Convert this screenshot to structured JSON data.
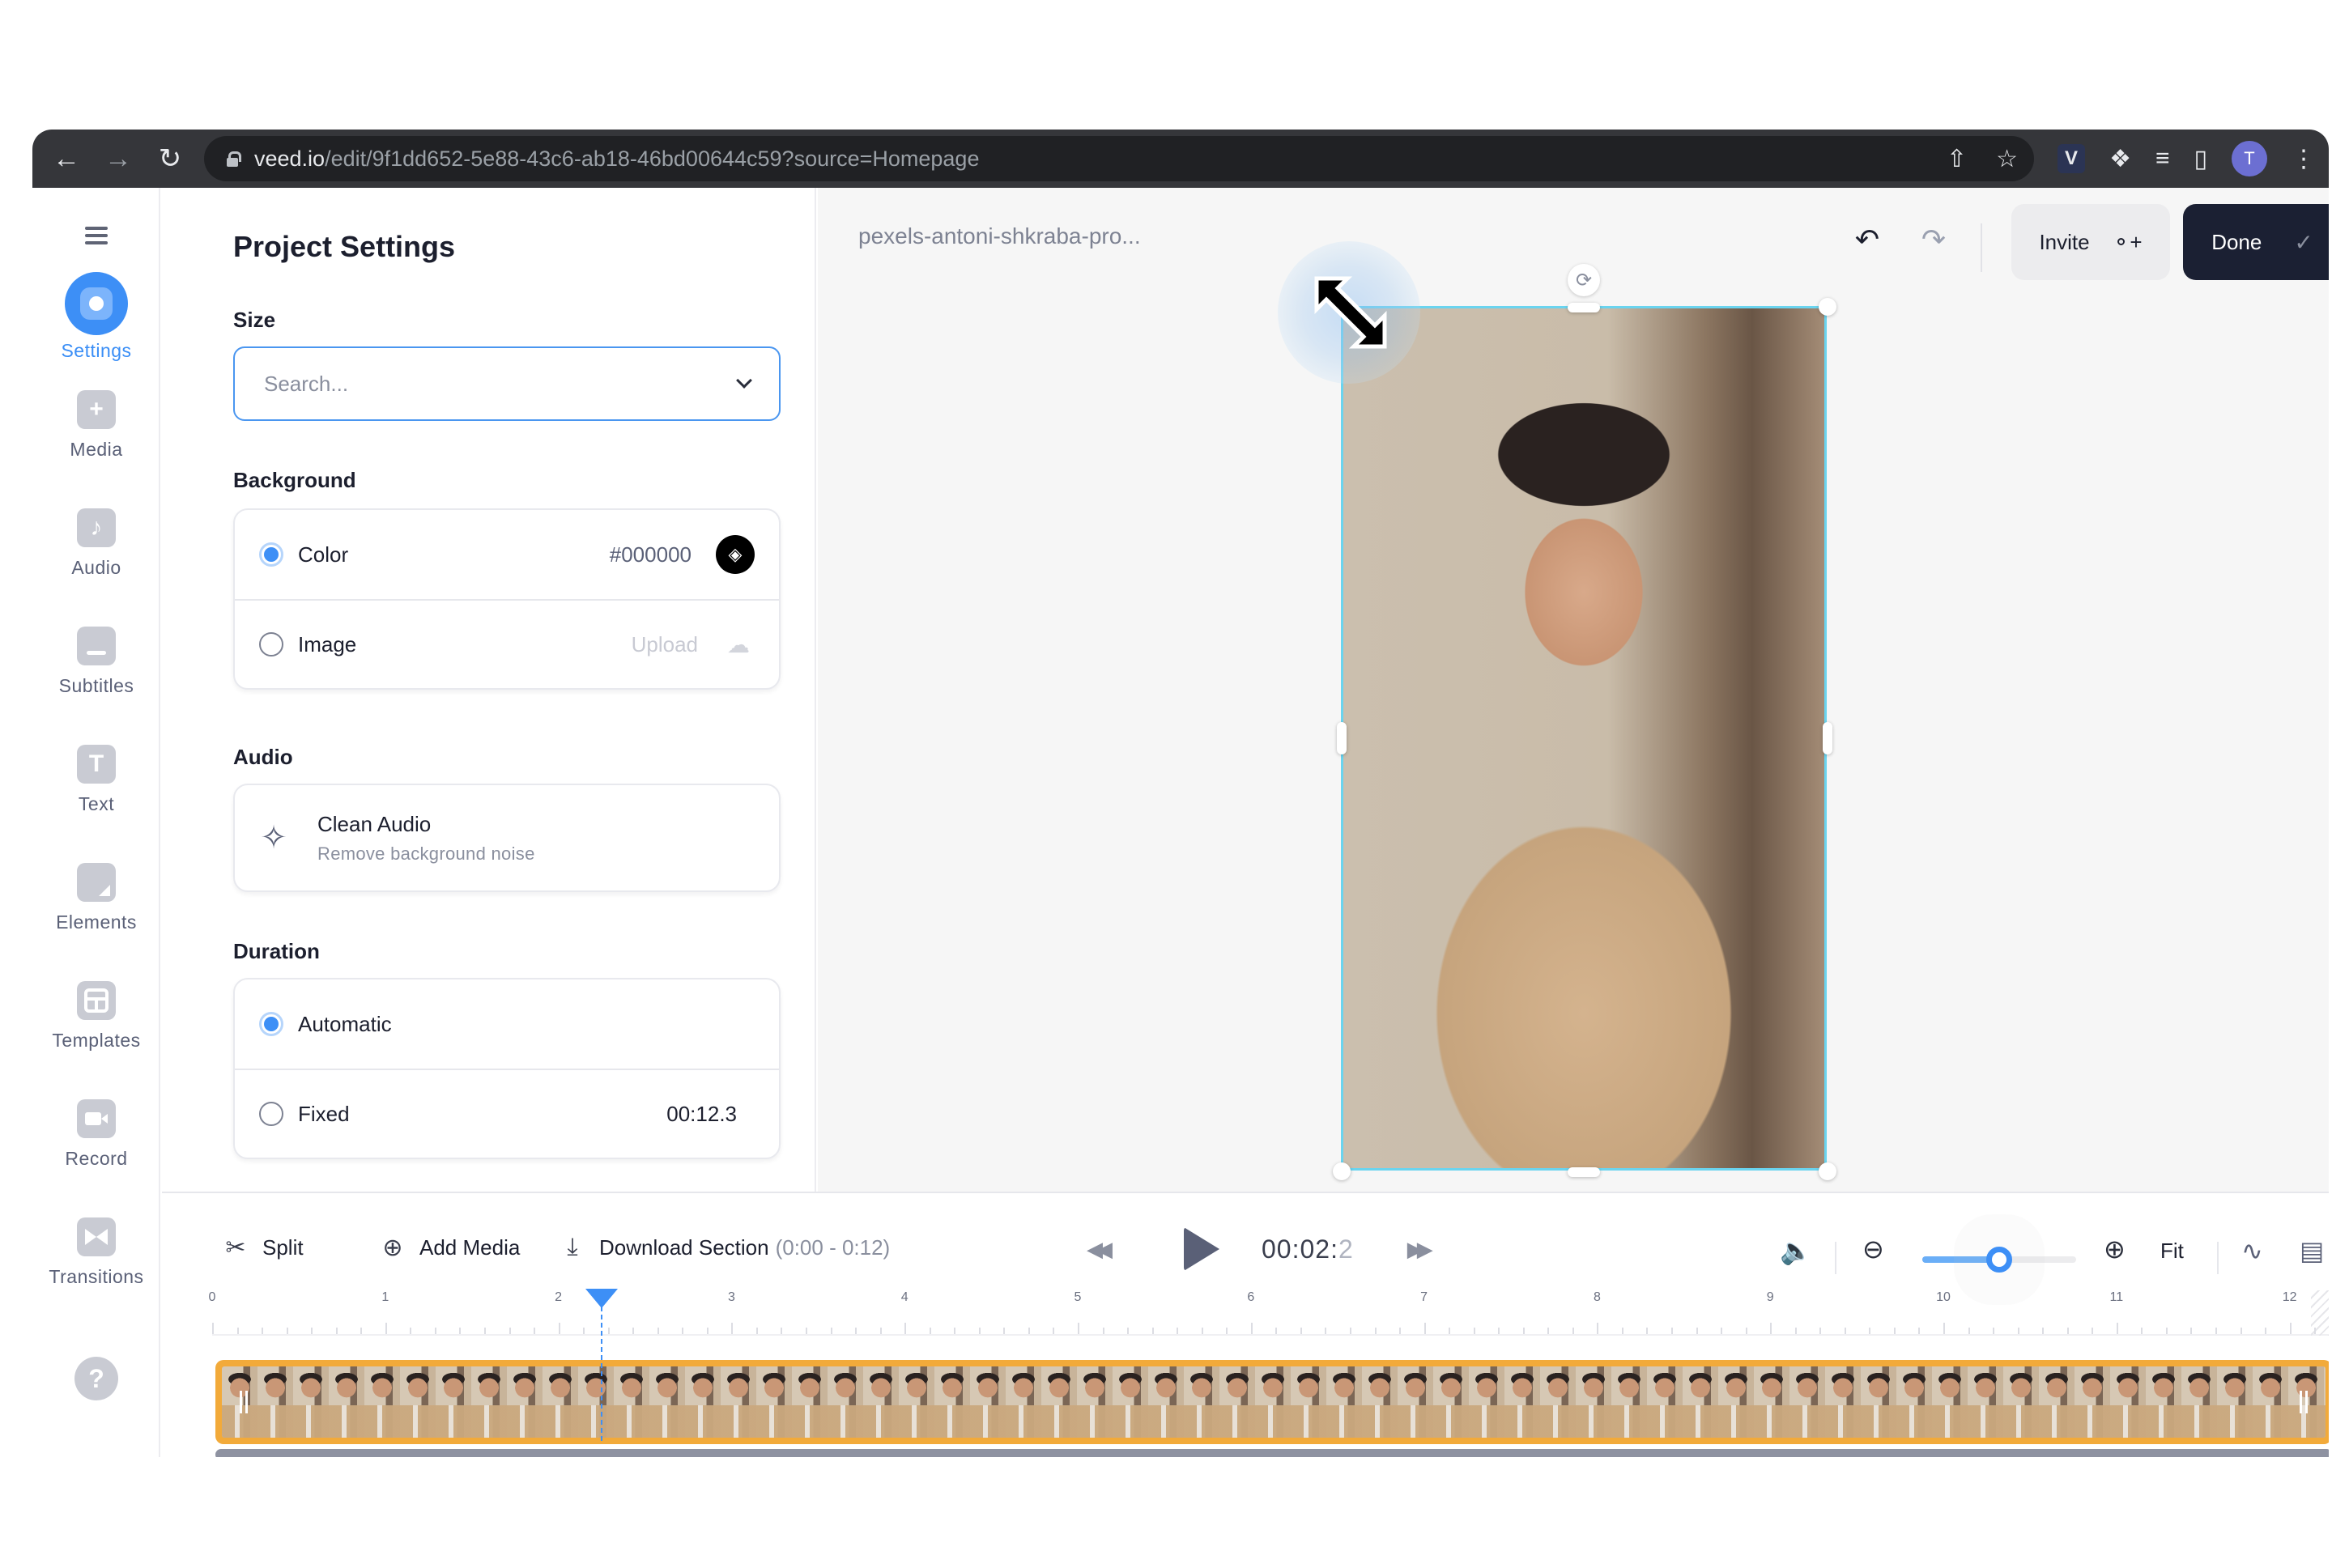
{
  "browser": {
    "url_host": "veed.io",
    "url_path": "/edit/9f1dd652-5e88-43c6-ab18-46bd00644c59?source=Homepage",
    "profile_initial": "T",
    "extension_label": "V",
    "icons": [
      "back-icon",
      "forward-icon",
      "reload-icon",
      "lock-icon",
      "share-icon",
      "star-icon",
      "veed-extension-icon",
      "puzzle-icon",
      "media-queue-icon",
      "side-panel-icon",
      "profile-avatar",
      "kebab-menu-icon"
    ]
  },
  "sidebar": {
    "items": [
      {
        "label": "Settings",
        "icon": "settings-icon",
        "active": true
      },
      {
        "label": "Media",
        "icon": "plus-icon",
        "active": false
      },
      {
        "label": "Audio",
        "icon": "music-note-icon",
        "active": false
      },
      {
        "label": "Subtitles",
        "icon": "subtitles-icon",
        "active": false
      },
      {
        "label": "Text",
        "icon": "text-icon",
        "active": false
      },
      {
        "label": "Elements",
        "icon": "sticker-icon",
        "active": false
      },
      {
        "label": "Templates",
        "icon": "layout-icon",
        "active": false
      },
      {
        "label": "Record",
        "icon": "video-camera-icon",
        "active": false
      },
      {
        "label": "Transitions",
        "icon": "transition-icon",
        "active": false
      }
    ],
    "help_label": "?"
  },
  "settings_panel": {
    "title": "Project Settings",
    "size": {
      "label": "Size",
      "placeholder": "Search...",
      "value": ""
    },
    "background": {
      "label": "Background",
      "options": [
        {
          "label": "Color",
          "selected": true,
          "value": "#000000",
          "action_icon": "paint-bucket-icon"
        },
        {
          "label": "Image",
          "selected": false,
          "value": "Upload",
          "action_icon": "cloud-upload-icon"
        }
      ]
    },
    "audio": {
      "label": "Audio",
      "clean_audio_title": "Clean Audio",
      "clean_audio_subtitle": "Remove background noise"
    },
    "duration": {
      "label": "Duration",
      "options": [
        {
          "label": "Automatic",
          "selected": true,
          "value": ""
        },
        {
          "label": "Fixed",
          "selected": false,
          "value": "00:12.3"
        }
      ]
    }
  },
  "canvas": {
    "filename": "pexels-antoni-shkraba-pro...",
    "invite_label": "Invite",
    "done_label": "Done"
  },
  "timeline": {
    "split_label": "Split",
    "add_media_label": "Add Media",
    "download_label": "Download Section",
    "download_range": "(0:00 - 0:12)",
    "timecode_main": "00:02:",
    "timecode_frac": "2",
    "fit_label": "Fit",
    "zoom_level_fraction": 0.5,
    "playhead_seconds": 2.25,
    "ruler_labels": [
      "0",
      "1",
      "2",
      "3",
      "4",
      "5",
      "6",
      "7",
      "8",
      "9",
      "10",
      "11",
      "12"
    ],
    "clip_duration_seconds": 12.3
  }
}
